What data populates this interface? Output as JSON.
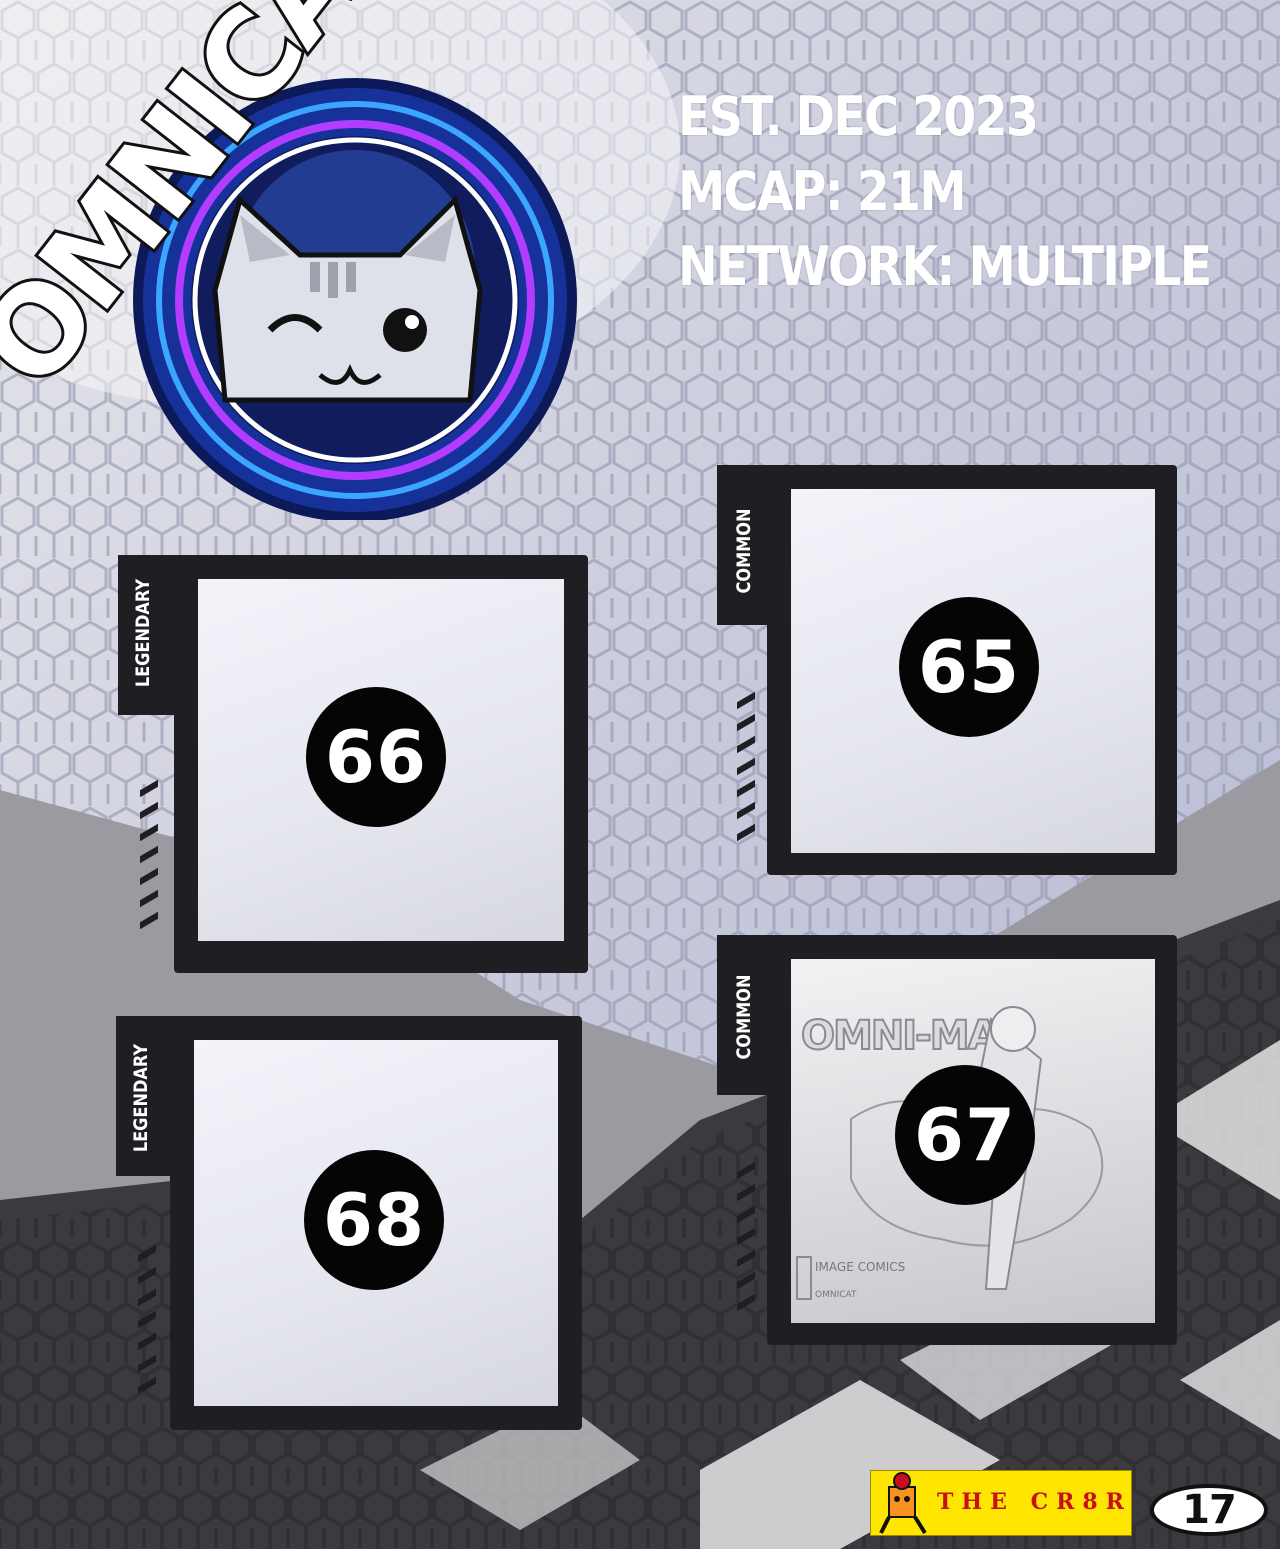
{
  "logo": {
    "wordmark": "OMNICAT"
  },
  "info": {
    "established": "EST. DEC 2023",
    "market_cap": "MCAP: 21M",
    "network": "NETWORK: MULTIPLE"
  },
  "cards": [
    {
      "rarity": "LEGENDARY",
      "number": "66"
    },
    {
      "rarity": "COMMON",
      "number": "65"
    },
    {
      "rarity": "LEGENDARY",
      "number": "68"
    },
    {
      "rarity": "COMMON",
      "number": "67",
      "cover_title": "OMNI-MAN",
      "publisher": "IMAGE COMICS",
      "publisher_sub": "OMNICAT"
    }
  ],
  "footer": {
    "brand": "THE CR8R",
    "page_number": "17"
  },
  "colors": {
    "background": "#b9bdd6",
    "frame": "#1f1e22",
    "badge": "#050505",
    "text_light": "#ffffff",
    "brand_yellow": "#ffe600",
    "brand_red": "#c8101d"
  }
}
